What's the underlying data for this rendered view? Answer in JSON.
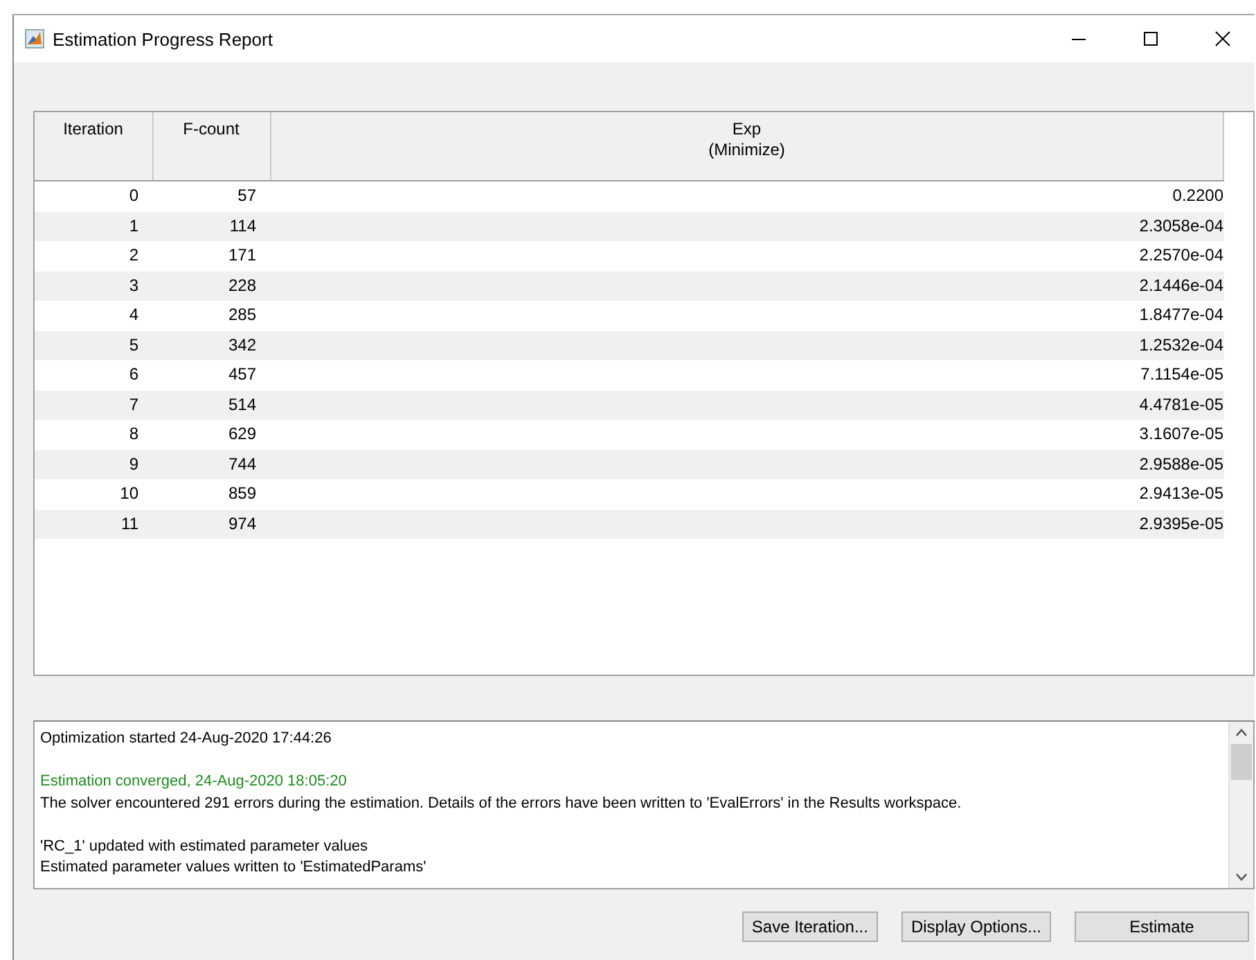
{
  "window": {
    "title": "Estimation Progress Report"
  },
  "table": {
    "columns": [
      {
        "label": "Iteration"
      },
      {
        "label": "F-count"
      },
      {
        "label": "Exp",
        "sublabel": "(Minimize)"
      }
    ],
    "rows": [
      [
        "0",
        "57",
        "0.2200"
      ],
      [
        "1",
        "114",
        "2.3058e-04"
      ],
      [
        "2",
        "171",
        "2.2570e-04"
      ],
      [
        "3",
        "228",
        "2.1446e-04"
      ],
      [
        "4",
        "285",
        "1.8477e-04"
      ],
      [
        "5",
        "342",
        "1.2532e-04"
      ],
      [
        "6",
        "457",
        "7.1154e-05"
      ],
      [
        "7",
        "514",
        "4.4781e-05"
      ],
      [
        "8",
        "629",
        "3.1607e-05"
      ],
      [
        "9",
        "744",
        "2.9588e-05"
      ],
      [
        "10",
        "859",
        "2.9413e-05"
      ],
      [
        "11",
        "974",
        "2.9395e-05"
      ]
    ]
  },
  "log": {
    "blocks": [
      {
        "lines": [
          {
            "kind": "info",
            "text": "Optimization started 24-Aug-2020 17:44:26"
          }
        ]
      },
      {
        "lines": [
          {
            "kind": "success",
            "text": "Estimation converged, 24-Aug-2020 18:05:20"
          },
          {
            "kind": "info",
            "text": "The solver encountered 291 errors during the estimation. Details of the errors have been written to 'EvalErrors' in the Results workspace."
          }
        ]
      },
      {
        "lines": [
          {
            "kind": "info",
            "text": "'RC_1' updated with estimated parameter values"
          },
          {
            "kind": "info",
            "text": "Estimated parameter values written to 'EstimatedParams'"
          }
        ]
      }
    ]
  },
  "buttons": [
    {
      "label": "Save Iteration..."
    },
    {
      "label": "Display Options..."
    },
    {
      "label": "Estimate"
    }
  ]
}
